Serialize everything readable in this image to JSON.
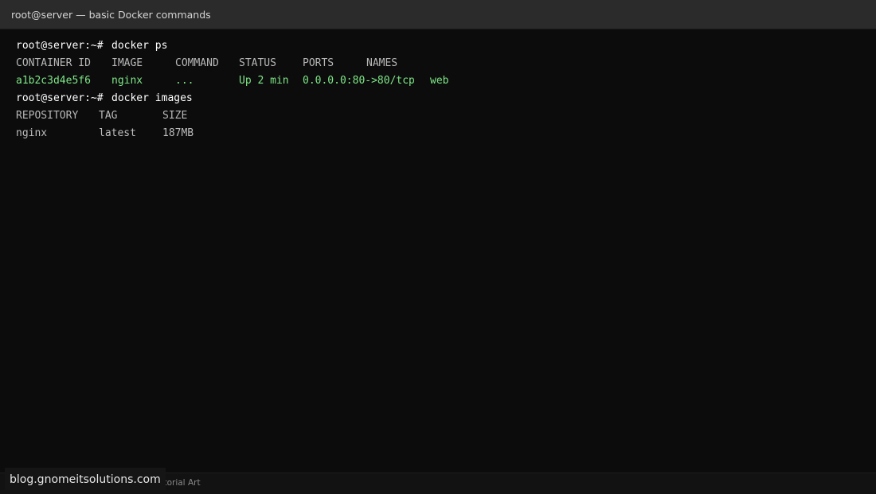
{
  "window": {
    "title": "root@server — basic Docker commands"
  },
  "terminal": {
    "prompt": "root@server:~#",
    "cmd1": "docker ps",
    "ps_headers": [
      "CONTAINER ID",
      "IMAGE",
      "COMMAND",
      "STATUS",
      "PORTS",
      "NAMES"
    ],
    "ps_row": [
      "a1b2c3d4e5f6",
      "nginx",
      "...",
      "Up 2 min",
      "0.0.0.0:80->80/tcp",
      "web"
    ],
    "cmd2": "docker images",
    "images_headers": [
      "REPOSITORY",
      "TAG",
      "SIZE"
    ],
    "images_row": [
      "nginx",
      "latest",
      "187MB"
    ]
  },
  "statusbar": {
    "text": "Tutorial Art"
  },
  "watermark": {
    "text": "blog.gnomeitsolutions.com"
  },
  "colors": {
    "background": "#0c0c0c",
    "titlebar": "#2b2b2b",
    "success_green": "#7ee787"
  }
}
